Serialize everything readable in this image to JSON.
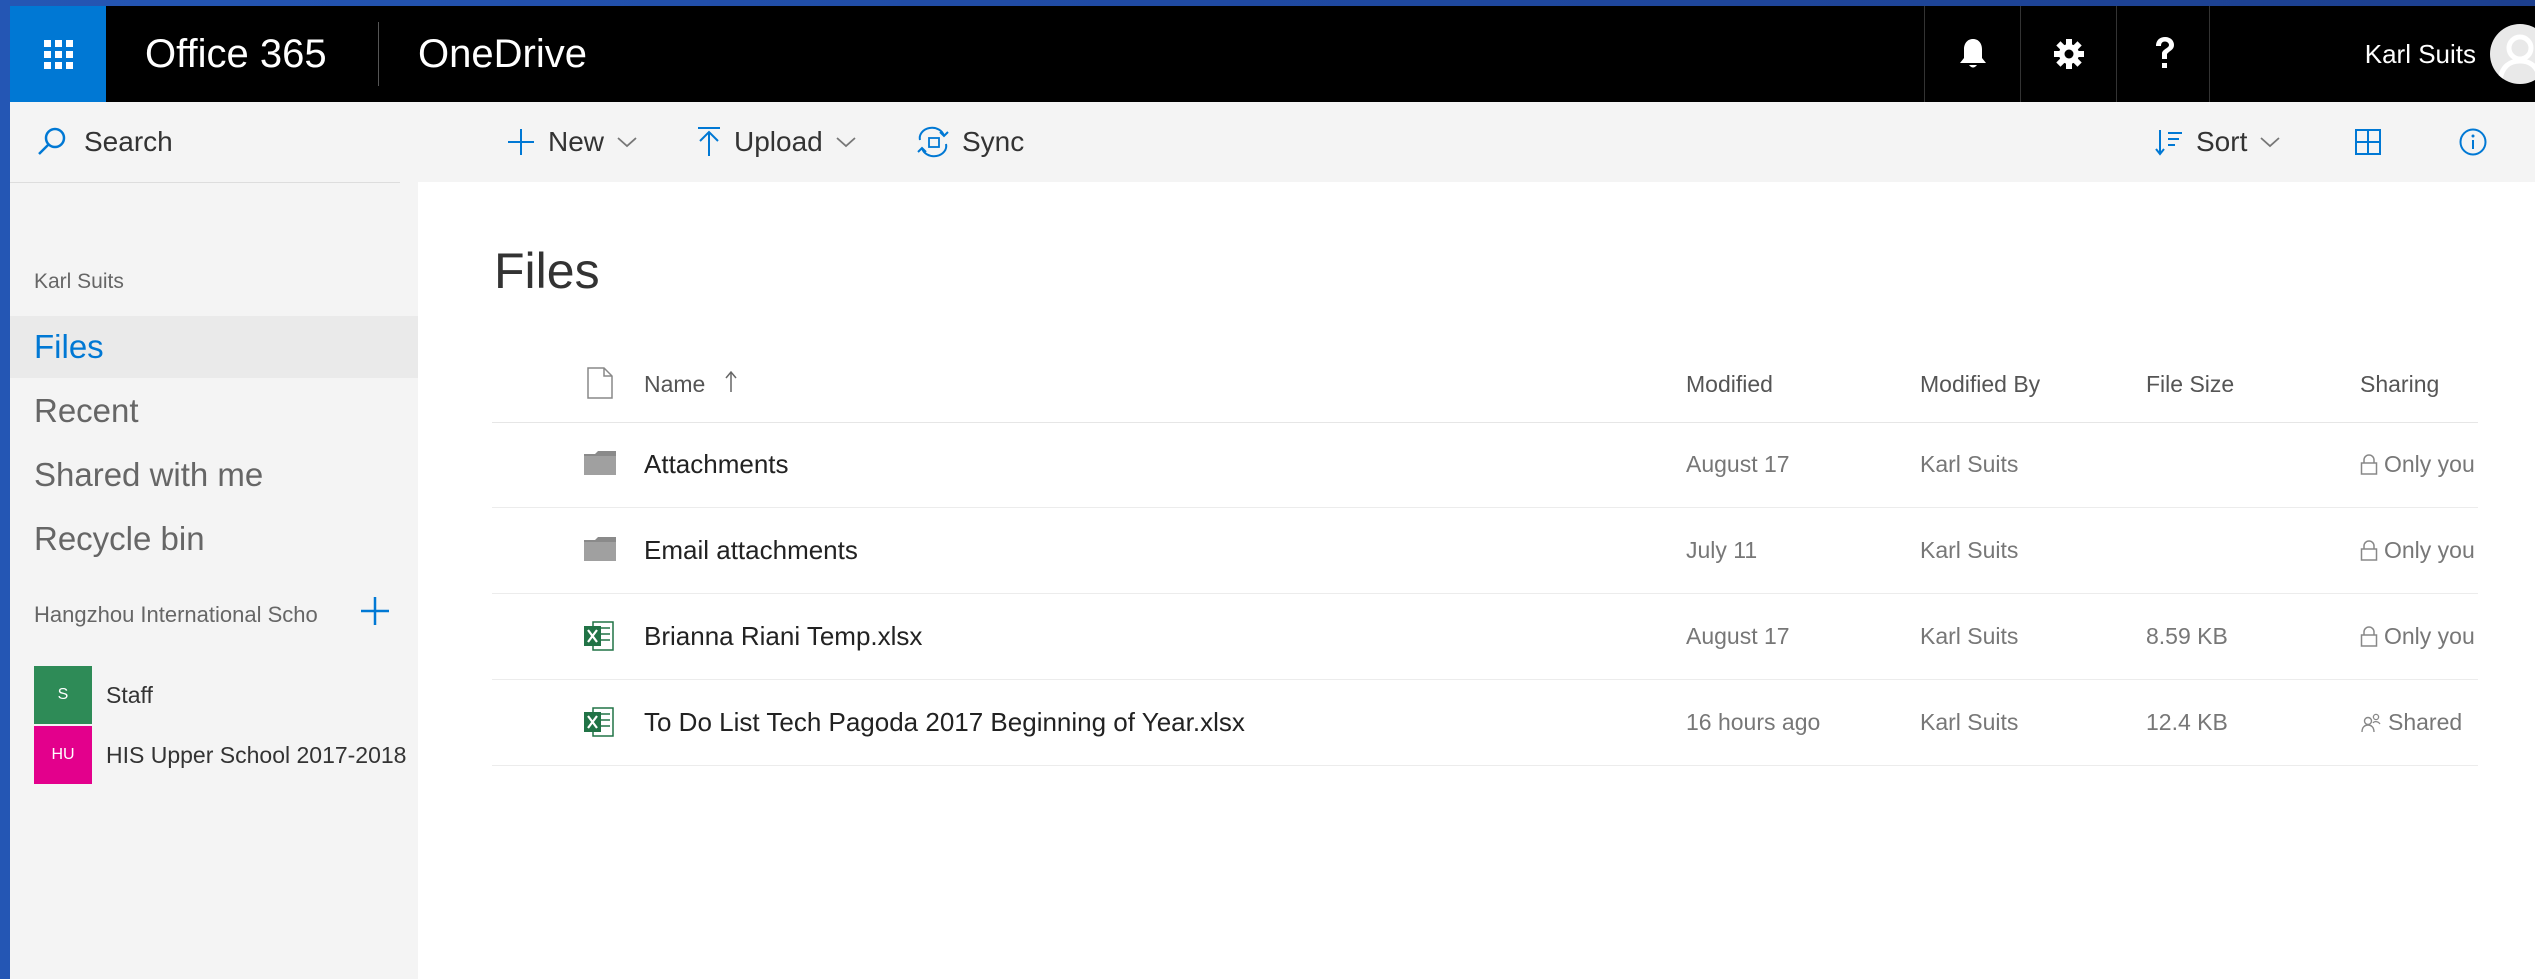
{
  "topbar": {
    "suite_name": "Office 365",
    "app_name": "OneDrive",
    "user_name": "Karl Suits",
    "icons": [
      "app-launcher-icon",
      "bell-icon",
      "gear-icon",
      "help-icon",
      "user-avatar-icon"
    ]
  },
  "left_nav": {
    "search_label": "Search",
    "owner": "Karl Suits",
    "items": [
      {
        "label": "Files",
        "selected": true
      },
      {
        "label": "Recent",
        "selected": false
      },
      {
        "label": "Shared with me",
        "selected": false
      },
      {
        "label": "Recycle bin",
        "selected": false
      }
    ],
    "group_label": "Hangzhou International Scho",
    "sites": [
      {
        "initials": "S",
        "name": "Staff",
        "color": "#2e8b57"
      },
      {
        "initials": "HU",
        "name": "HIS Upper School 2017-2018",
        "color": "#e3008c"
      }
    ]
  },
  "command_bar": {
    "new_label": "New",
    "upload_label": "Upload",
    "sync_label": "Sync",
    "sort_label": "Sort"
  },
  "main": {
    "title": "Files",
    "columns": {
      "name": "Name",
      "modified": "Modified",
      "modified_by": "Modified By",
      "file_size": "File Size",
      "sharing": "Sharing"
    },
    "rows": [
      {
        "type": "folder",
        "name": "Attachments",
        "modified": "August 17",
        "modified_by": "Karl Suits",
        "size": "",
        "sharing": "Only you",
        "sharing_icon": "lock-icon"
      },
      {
        "type": "folder",
        "name": "Email attachments",
        "modified": "July 11",
        "modified_by": "Karl Suits",
        "size": "",
        "sharing": "Only you",
        "sharing_icon": "lock-icon"
      },
      {
        "type": "excel",
        "name": "Brianna Riani Temp.xlsx",
        "modified": "August 17",
        "modified_by": "Karl Suits",
        "size": "8.59 KB",
        "sharing": "Only you",
        "sharing_icon": "lock-icon"
      },
      {
        "type": "excel",
        "name": "To Do List Tech Pagoda 2017 Beginning of Year.xlsx",
        "modified": "16 hours ago",
        "modified_by": "Karl Suits",
        "size": "12.4 KB",
        "sharing": "Shared",
        "sharing_icon": "people-icon"
      }
    ]
  },
  "colors": {
    "accent": "#0078d4",
    "topbar": "#000000",
    "excel": "#217346",
    "folder": "#8a8a8a"
  }
}
